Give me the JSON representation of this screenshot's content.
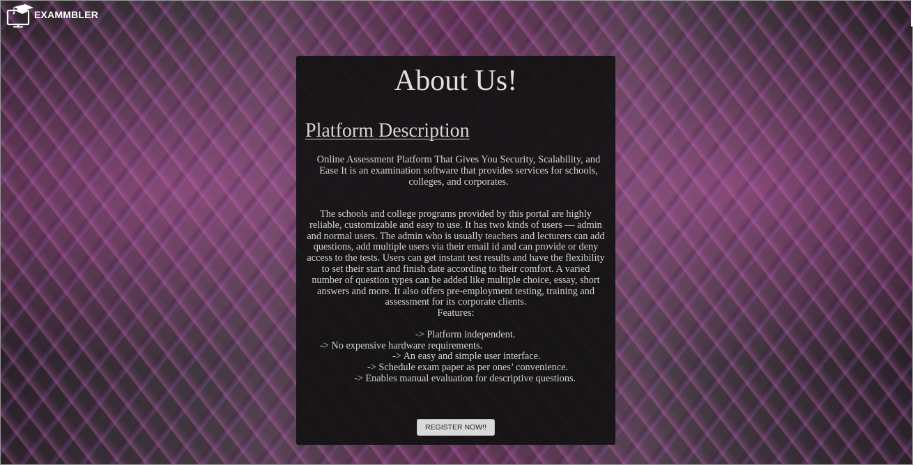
{
  "brand": {
    "name": "EXAMMBLER",
    "logo_icon": "monitor-graduation-cap-icon",
    "color": "#ffffff"
  },
  "about": {
    "title": "About Us!",
    "subtitle": "Platform Description",
    "tagline": "Online Assessment Platform That Gives You Security, Scalability, and Ease It is an examination software that provides services for schools, colleges, and corporates.",
    "description": "The schools and college programs provided by this portal are highly reliable, customizable and easy to use. It has two kinds of users — admin and normal users. The admin who is usually teachers and lecturers can add questions, add multiple users via their email id and can provide or deny access to the tests. Users can get instant test results and have the flexibility to set their start and finish date according to their comfort. A varied number of question types can be added like multiple choice, essay, short answers and more. It also offers pre-employment testing, training and assessment for its corporate clients.",
    "features_heading": "Features:",
    "features": [
      "-> Platform independent.",
      "-> No expensive hardware requirements.",
      "-> An easy and simple user interface.",
      "-> Schedule exam paper as per ones’ convenience.",
      "-> Enables manual evaluation for descriptive questions."
    ],
    "register_label": "REGISTER NOW!!"
  },
  "colors": {
    "card_background": "#121212",
    "text": "#d4d4d4",
    "button_background": "#d9d9d9",
    "page_accent": "#dc6ebe"
  }
}
